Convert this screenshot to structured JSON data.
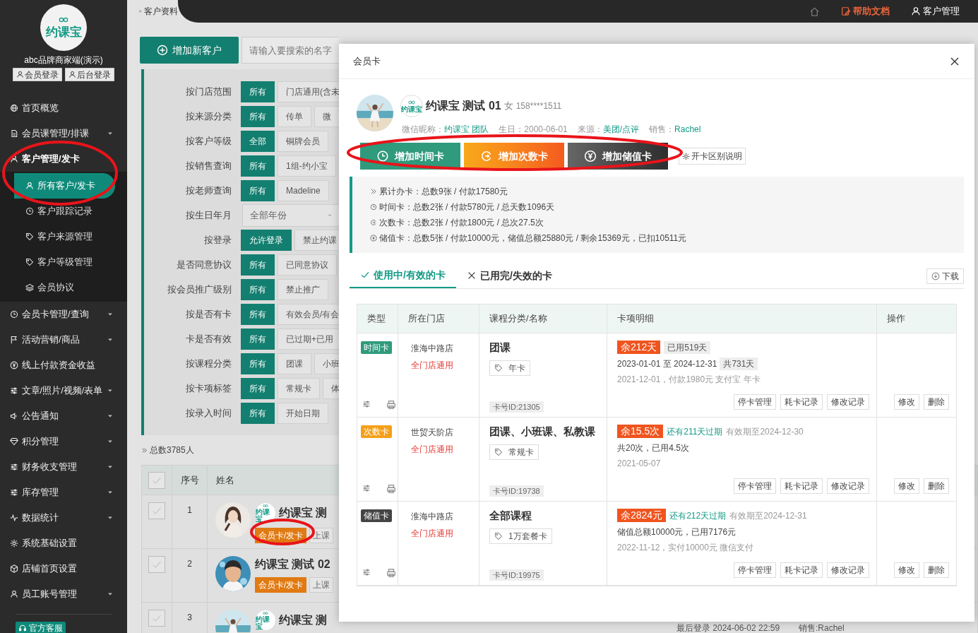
{
  "sidebar": {
    "logo_text": "约课宝",
    "brand": "abc品牌商家端(演示)",
    "login_buttons": [
      "会员登录",
      "后台登录"
    ],
    "items": [
      {
        "label": "首页概览",
        "caret": false,
        "expanded": false
      },
      {
        "label": "会员课管理/排课",
        "caret": true,
        "expanded": false
      },
      {
        "label": "客户管理/发卡",
        "caret": false,
        "expanded": true,
        "children": [
          {
            "label": "所有客户/发卡",
            "selected": true
          },
          {
            "label": "客户跟踪记录",
            "selected": false
          },
          {
            "label": "客户来源管理",
            "selected": false
          },
          {
            "label": "客户等级管理",
            "selected": false
          },
          {
            "label": "会员协议",
            "selected": false
          }
        ]
      },
      {
        "label": "会员卡管理/查询",
        "caret": true,
        "expanded": false
      },
      {
        "label": "活动营销/商品",
        "caret": true,
        "expanded": false
      },
      {
        "label": "线上付款资金收益",
        "caret": false,
        "expanded": false
      },
      {
        "label": "文章/照片/视频/表单",
        "caret": true,
        "expanded": false
      },
      {
        "label": "公告通知",
        "caret": true,
        "expanded": false
      },
      {
        "label": "积分管理",
        "caret": true,
        "expanded": false
      },
      {
        "label": "财务收支管理",
        "caret": true,
        "expanded": false
      },
      {
        "label": "库存管理",
        "caret": true,
        "expanded": false
      },
      {
        "label": "数据统计",
        "caret": true,
        "expanded": false
      },
      {
        "label": "系统基础设置",
        "caret": false,
        "expanded": false
      },
      {
        "label": "店铺首页设置",
        "caret": false,
        "expanded": false
      },
      {
        "label": "员工账号管理",
        "caret": true,
        "expanded": false
      }
    ],
    "support": "官方客服"
  },
  "header": {
    "breadcrumb": "客户资料",
    "links": [
      {
        "kind": "home"
      },
      {
        "kind": "help",
        "label": "帮助文档"
      },
      {
        "kind": "user",
        "label": "客户管理"
      }
    ]
  },
  "toolbar": {
    "add_button": "增加新客户",
    "search": {
      "placeholder": "请输入要搜索的名字"
    }
  },
  "filters": [
    {
      "label": "按门店范围",
      "kind": "options",
      "options": [
        {
          "text": "所有",
          "selected": true
        },
        {
          "text": "门店通用(含未",
          "selected": false
        }
      ]
    },
    {
      "label": "按来源分类",
      "kind": "options",
      "options": [
        {
          "text": "所有",
          "selected": true
        },
        {
          "text": "传单",
          "selected": false
        },
        {
          "text": "微",
          "selected": false
        }
      ]
    },
    {
      "label": "按客户等级",
      "kind": "options",
      "options": [
        {
          "text": "全部",
          "selected": true
        },
        {
          "text": "铜牌会员",
          "selected": false
        }
      ]
    },
    {
      "label": "按销售查询",
      "kind": "options",
      "options": [
        {
          "text": "所有",
          "selected": true
        },
        {
          "text": "1组-约小宝",
          "selected": false
        }
      ]
    },
    {
      "label": "按老师查询",
      "kind": "options",
      "options": [
        {
          "text": "所有",
          "selected": true
        },
        {
          "text": "Madeline",
          "selected": false
        }
      ]
    },
    {
      "label": "按生日年月",
      "kind": "select",
      "value": "全部年份"
    },
    {
      "label": "按登录",
      "kind": "options",
      "options": [
        {
          "text": "允许登录",
          "selected": true
        },
        {
          "text": "禁止约课",
          "selected": false
        }
      ]
    },
    {
      "label": "是否同意协议",
      "kind": "options",
      "options": [
        {
          "text": "所有",
          "selected": true
        },
        {
          "text": "已同意协议",
          "selected": false
        }
      ]
    },
    {
      "label": "按会员推广级别",
      "kind": "options",
      "options": [
        {
          "text": "所有",
          "selected": true
        },
        {
          "text": "禁止推广",
          "selected": false
        }
      ]
    },
    {
      "label": "按是否有卡",
      "kind": "options",
      "options": [
        {
          "text": "所有",
          "selected": true
        },
        {
          "text": "有效会员/有会",
          "selected": false
        }
      ]
    },
    {
      "label": "卡是否有效",
      "kind": "options",
      "options": [
        {
          "text": "所有",
          "selected": true
        },
        {
          "text": "已过期+已用",
          "selected": false
        }
      ]
    },
    {
      "label": "按课程分类",
      "kind": "options",
      "options": [
        {
          "text": "所有",
          "selected": true
        },
        {
          "text": "团课",
          "selected": false
        },
        {
          "text": "小班",
          "selected": false
        }
      ]
    },
    {
      "label": "按卡项标签",
      "kind": "options",
      "options": [
        {
          "text": "所有",
          "selected": true
        },
        {
          "text": "常规卡",
          "selected": false
        },
        {
          "text": "体",
          "selected": false
        }
      ]
    },
    {
      "label": "按录入时间",
      "kind": "options",
      "options": [
        {
          "text": "所有",
          "selected": true
        },
        {
          "text": "开始日期",
          "selected": false
        }
      ]
    }
  ],
  "customer_list": {
    "total": "总数3785人",
    "header_checked": false,
    "columns": [
      "序号",
      "姓名"
    ],
    "rows": [
      {
        "checked": false,
        "index": "1",
        "logo_text": "约课宝",
        "name": "约课宝 测",
        "card_button": "会员卡/发卡",
        "class_button": "上课"
      },
      {
        "checked": false,
        "index": "2",
        "name": "约课宝 测试 02",
        "card_button": "会员卡/发卡",
        "class_button": "上课"
      },
      {
        "checked": false,
        "index": "3",
        "logo_text": "约课宝",
        "name": "约课宝 测",
        "last_login": "最后登录 2024-06-02 22:59",
        "sales": "销售:Rachel"
      }
    ]
  },
  "modal": {
    "title": "会员卡",
    "profile": {
      "logo_text": "约课宝",
      "name": "约课宝 测试 01",
      "gender": "女",
      "phone": "158****1511",
      "fields": [
        {
          "label": "微信昵称：",
          "value": "约课宝 团队",
          "kind": "link"
        },
        {
          "label": "生日：",
          "value": "2000-06-01",
          "kind": "plain"
        },
        {
          "label": "来源：",
          "value": "美团/点评",
          "kind": "link"
        },
        {
          "label": "销售：",
          "value": "Rachel",
          "kind": "link"
        }
      ]
    },
    "actions": [
      {
        "kind": "time",
        "label": "增加时间卡"
      },
      {
        "kind": "count",
        "label": "增加次数卡"
      },
      {
        "kind": "value",
        "label": "增加储值卡"
      },
      {
        "kind": "help",
        "label": "开卡区别说明"
      }
    ],
    "summary": [
      {
        "kind": "total",
        "text": "累计办卡：总数9张 / 付款17580元"
      },
      {
        "kind": "time",
        "text": "时间卡：总数2张 / 付款5780元 / 总天数1096天"
      },
      {
        "kind": "count",
        "text": "次数卡：总数2张 / 付款1800元 / 总次27.5次"
      },
      {
        "kind": "value",
        "text": "储值卡：总数5张 / 付款10000元，储值总额25880元 / 剩余15369元，已扣10511元"
      }
    ],
    "tabs": [
      {
        "label": "使用中/有效的卡",
        "selected": true
      },
      {
        "label": "已用完/失效的卡",
        "selected": false
      }
    ],
    "download": "下载",
    "table": {
      "columns": [
        "类型",
        "所在门店",
        "课程分类/名称",
        "卡项明细",
        "操作"
      ],
      "rows": [
        {
          "kind": "time",
          "type": "时间卡",
          "store": "淮海中路店",
          "scope": "全门店通用",
          "course": "团课",
          "tag": "年卡",
          "card_id": "卡号ID:21305",
          "remain": "余212天",
          "head": [
            {
              "kind": "badge",
              "text": "已用519天"
            }
          ],
          "line": "2023-01-01 至 2024-12-31",
          "line_badge": "共731天",
          "note": "2021-12-01，付款1980元 支付宝 年卡",
          "card_actions": [
            "停卡管理",
            "耗卡记录",
            "修改记录"
          ],
          "row_actions": [
            "修改",
            "删除"
          ]
        },
        {
          "kind": "count",
          "type": "次数卡",
          "store": "世贸天阶店",
          "scope": "全门店通用",
          "course": "团课、小班课、私教课",
          "tag": "常规卡",
          "card_id": "卡号ID:19738",
          "remain": "余15.5次",
          "head": [
            {
              "kind": "notice",
              "text": "还有211天过期"
            },
            {
              "kind": "muted",
              "text": "有效期至2024-12-30"
            }
          ],
          "line": "共20次，已用4.5次",
          "note": "2021-05-07",
          "card_actions": [
            "停卡管理",
            "耗卡记录",
            "修改记录"
          ],
          "row_actions": [
            "修改",
            "删除"
          ]
        },
        {
          "kind": "value",
          "type": "储值卡",
          "store": "淮海中路店",
          "scope": "全门店通用",
          "course": "全部课程",
          "tag": "1万套餐卡",
          "card_id": "卡号ID:19975",
          "remain": "余2824元",
          "head": [
            {
              "kind": "notice",
              "text": "还有212天过期"
            },
            {
              "kind": "muted",
              "text": "有效期至2024-12-31"
            }
          ],
          "line": "储值总额10000元，已用7176元",
          "note": "2022-11-12，实付10000元 微信支付",
          "card_actions": [
            "停卡管理",
            "耗卡记录",
            "修改记录"
          ],
          "row_actions": [
            "修改",
            "删除"
          ]
        }
      ]
    }
  }
}
